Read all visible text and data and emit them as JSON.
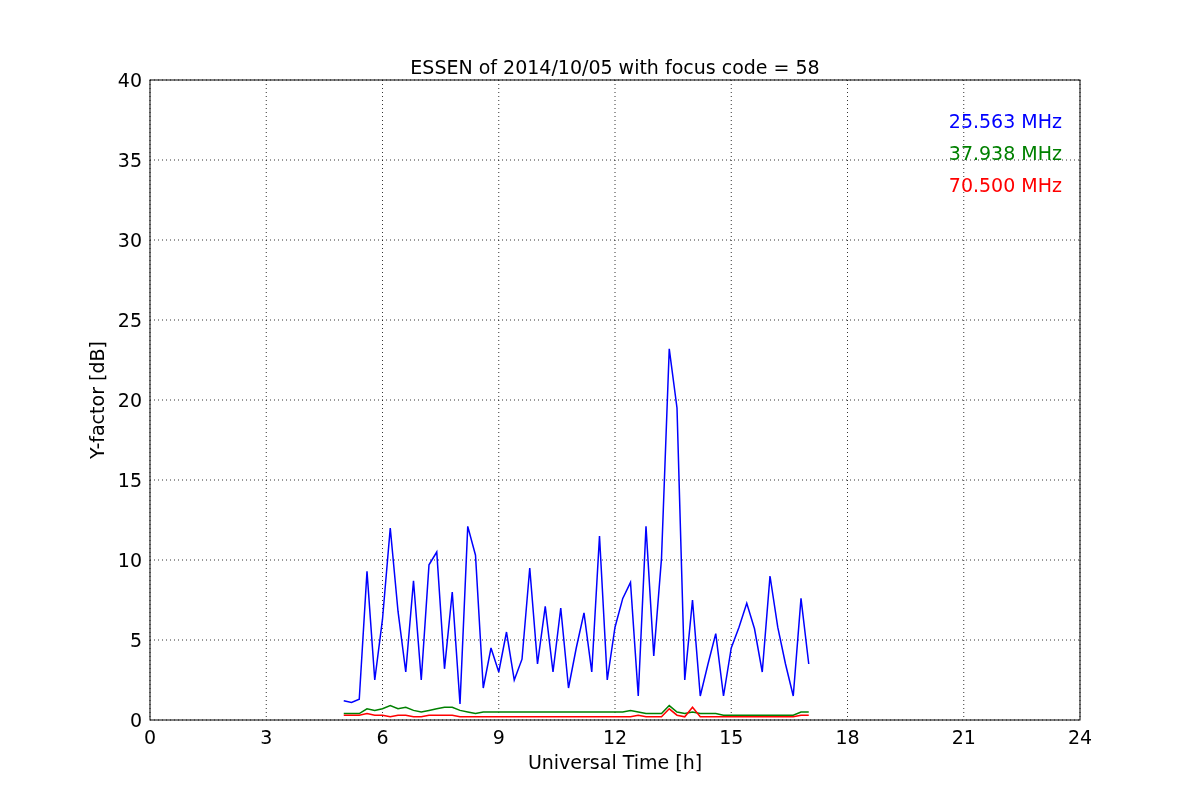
{
  "figure": {
    "chart_data": {
      "type": "line",
      "title": "ESSEN of 2014/10/05 with focus code = 58",
      "xlabel": "Universal Time [h]",
      "ylabel": "Y-factor [dB]",
      "x": [
        5.0,
        5.2,
        5.4,
        5.6,
        5.8,
        6.0,
        6.2,
        6.4,
        6.6,
        6.8,
        7.0,
        7.2,
        7.4,
        7.6,
        7.8,
        8.0,
        8.2,
        8.4,
        8.6,
        8.8,
        9.0,
        9.2,
        9.4,
        9.6,
        9.8,
        10.0,
        10.2,
        10.4,
        10.6,
        10.8,
        11.0,
        11.2,
        11.4,
        11.6,
        11.8,
        12.0,
        12.2,
        12.4,
        12.6,
        12.8,
        13.0,
        13.2,
        13.4,
        13.6,
        13.8,
        14.0,
        14.2,
        14.4,
        14.6,
        14.8,
        15.0,
        15.2,
        15.4,
        15.6,
        15.8,
        16.0,
        16.2,
        16.4,
        16.6,
        16.8,
        17.0
      ],
      "series": [
        {
          "name": "25.563 MHz",
          "color": "#0000ff",
          "values": [
            1.2,
            1.1,
            1.3,
            9.3,
            2.5,
            6.3,
            12.0,
            6.8,
            3.0,
            8.7,
            2.5,
            9.7,
            10.5,
            3.2,
            8.0,
            1.0,
            12.1,
            10.3,
            2.0,
            4.5,
            3.0,
            5.5,
            2.5,
            3.8,
            9.5,
            3.5,
            7.1,
            3.0,
            7.0,
            2.0,
            4.5,
            6.7,
            3.0,
            11.5,
            2.5,
            5.8,
            7.6,
            8.6,
            1.5,
            12.1,
            4.0,
            10.1,
            23.2,
            19.5,
            2.5,
            7.5,
            1.5,
            3.5,
            5.4,
            1.5,
            4.5,
            5.8,
            7.3,
            5.7,
            3.0,
            9.0,
            5.8,
            3.5,
            1.5,
            7.6,
            3.5
          ]
        },
        {
          "name": "37.938 MHz",
          "color": "#008000",
          "values": [
            0.4,
            0.4,
            0.4,
            0.7,
            0.6,
            0.7,
            0.9,
            0.7,
            0.8,
            0.6,
            0.5,
            0.6,
            0.7,
            0.8,
            0.8,
            0.6,
            0.5,
            0.4,
            0.5,
            0.5,
            0.5,
            0.5,
            0.5,
            0.5,
            0.5,
            0.5,
            0.5,
            0.5,
            0.5,
            0.5,
            0.5,
            0.5,
            0.5,
            0.5,
            0.5,
            0.5,
            0.5,
            0.6,
            0.5,
            0.4,
            0.4,
            0.4,
            0.9,
            0.5,
            0.4,
            0.5,
            0.4,
            0.4,
            0.4,
            0.3,
            0.3,
            0.3,
            0.3,
            0.3,
            0.3,
            0.3,
            0.3,
            0.3,
            0.3,
            0.5,
            0.5
          ]
        },
        {
          "name": "70.500 MHz",
          "color": "#ff0000",
          "values": [
            0.3,
            0.3,
            0.3,
            0.4,
            0.3,
            0.3,
            0.2,
            0.3,
            0.3,
            0.2,
            0.2,
            0.3,
            0.3,
            0.3,
            0.3,
            0.2,
            0.2,
            0.2,
            0.2,
            0.2,
            0.2,
            0.2,
            0.2,
            0.2,
            0.2,
            0.2,
            0.2,
            0.2,
            0.2,
            0.2,
            0.2,
            0.2,
            0.2,
            0.2,
            0.2,
            0.2,
            0.2,
            0.2,
            0.3,
            0.2,
            0.2,
            0.2,
            0.7,
            0.3,
            0.2,
            0.8,
            0.2,
            0.2,
            0.2,
            0.2,
            0.2,
            0.2,
            0.2,
            0.2,
            0.2,
            0.2,
            0.2,
            0.2,
            0.2,
            0.3,
            0.3
          ]
        }
      ],
      "xlim": [
        0,
        24
      ],
      "ylim": [
        0,
        40
      ],
      "xticks": [
        0,
        3,
        6,
        9,
        12,
        15,
        18,
        21,
        24
      ],
      "yticks": [
        0,
        5,
        10,
        15,
        20,
        25,
        30,
        35,
        40
      ],
      "grid": true
    }
  }
}
